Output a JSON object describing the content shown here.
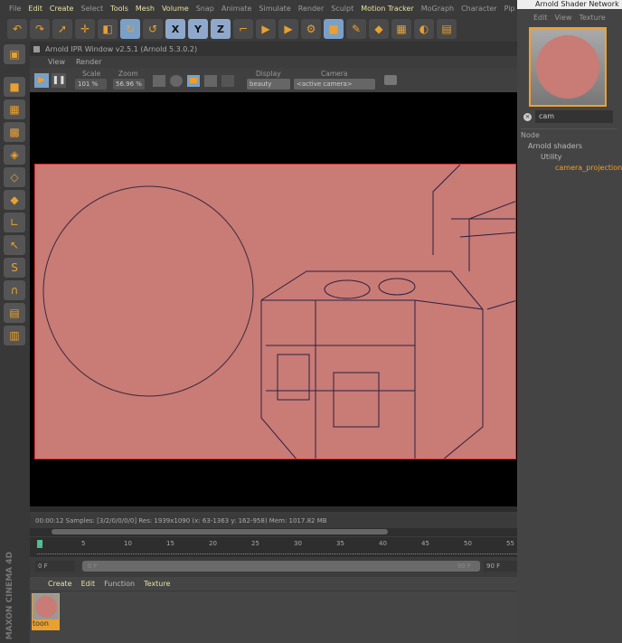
{
  "menubar": [
    "File",
    "Edit",
    "Create",
    "Select",
    "Tools",
    "Mesh",
    "Volume",
    "Snap",
    "Animate",
    "Simulate",
    "Render",
    "Sculpt",
    "Motion Tracker",
    "MoGraph",
    "Character",
    "Pip"
  ],
  "toolbar_icons": [
    "undo-icon",
    "redo-icon",
    "live-select-icon",
    "move-icon",
    "scale-icon",
    "rotate-icon",
    "rotate-alt-icon",
    "x-axis-icon",
    "y-axis-icon",
    "z-axis-icon",
    "coordinate-system-icon",
    "render-view-icon",
    "render-picture-viewer-icon",
    "render-settings-icon",
    "cube-icon",
    "pen-icon",
    "subdivision-icon",
    "array-icon",
    "deformer-icon",
    "floor-icon"
  ],
  "axes": [
    "X",
    "Y",
    "Z"
  ],
  "ipr": {
    "title": "Arnold IPR Window v2.5.1 (Arnold 5.3.0.2)",
    "menu": [
      "View",
      "Render"
    ],
    "scale_label": "Scale",
    "scale_value": "101 %",
    "zoom_label": "Zoom",
    "zoom_value": "56.96 %",
    "display_label": "Display",
    "display_value": "beauty",
    "camera_label": "Camera",
    "camera_value": "<active camera>"
  },
  "status": "00:00:12  Samples: [3/2/0/0/0/0]  Res: 1939x1090 (x: 63-1363 y: 162-958)  Mem: 1017.82 MB",
  "timeline": {
    "ticks": [
      "0",
      "5",
      "10",
      "15",
      "20",
      "25",
      "30",
      "35",
      "40",
      "45",
      "50",
      "55"
    ],
    "current": "0 F",
    "start": "0 F",
    "end_inner": "90 F",
    "end": "90 F"
  },
  "material_panel": {
    "menu": [
      "Create",
      "Edit",
      "Function",
      "Texture"
    ],
    "material_name": "toon"
  },
  "brand": "MAXON CINEMA 4D",
  "shader_network": {
    "title": "Arnold Shader Network E",
    "menu": [
      "Edit",
      "View",
      "Texture"
    ],
    "search_value": "cam",
    "tree_header": "Node",
    "tree": [
      "Arnold shaders",
      "Utility",
      "camera_projection"
    ]
  },
  "colors": {
    "accent": "#e9a030",
    "render_bg": "#c97b76",
    "selected_node": "#f0a030"
  }
}
